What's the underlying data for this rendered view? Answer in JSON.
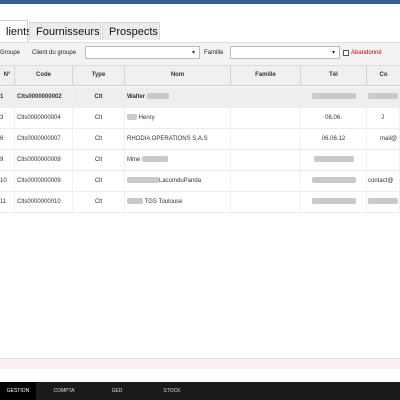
{
  "tabs": [
    {
      "label": "lients",
      "active": true
    },
    {
      "label": "Fournisseurs",
      "active": false
    },
    {
      "label": "Prospects",
      "active": false
    }
  ],
  "filters": {
    "group_label": "Groupe",
    "client_group_label": "Client du groupe",
    "client_group_value": "",
    "famille_label": "Famille",
    "famille_value": "",
    "abandonne_label": "Abandonné",
    "abandonne_checked": false
  },
  "table": {
    "columns": [
      "N°",
      "Code",
      "Type",
      "Nom",
      "Famille",
      "Tél",
      "Co"
    ],
    "rows": [
      {
        "num": "1",
        "code": "Clts0000000002",
        "type": "Clt",
        "nom": "Walter",
        "famille": "",
        "tel": "",
        "contact": "",
        "selected": true
      },
      {
        "num": "3",
        "code": "Clts0000000004",
        "type": "Clt",
        "nom": "Henry",
        "famille": "",
        "tel": "06.06.",
        "contact": "J",
        "selected": false
      },
      {
        "num": "6",
        "code": "Clts0000000007",
        "type": "Clt",
        "nom": "RHODIA OPERATIONS S.A.S",
        "famille": "",
        "tel": "06.06.12",
        "contact": "mail@",
        "selected": false
      },
      {
        "num": "9",
        "code": "Clts0000000008",
        "type": "Clt",
        "nom": "Mme",
        "famille": "",
        "tel": "",
        "contact": "",
        "selected": false
      },
      {
        "num": "10",
        "code": "Clts0000000009",
        "type": "Clt",
        "nom": "LacomduPanda",
        "famille": "",
        "tel": "",
        "contact": "contact@",
        "selected": false
      },
      {
        "num": "11",
        "code": "Clts0000000010",
        "type": "Clt",
        "nom": "TGS Toulouse",
        "famille": "",
        "tel": "",
        "contact": "",
        "selected": false
      }
    ]
  },
  "footer": {
    "items": [
      {
        "label": "GESTION",
        "active": true
      },
      {
        "label": "COMPTA",
        "active": false
      },
      {
        "label": "GED",
        "active": false
      },
      {
        "label": "STOCK",
        "active": false
      }
    ]
  },
  "colors": {
    "accent": "#3a5f8f",
    "warning": "#d00000",
    "footer_bg": "#1a1a1a"
  }
}
